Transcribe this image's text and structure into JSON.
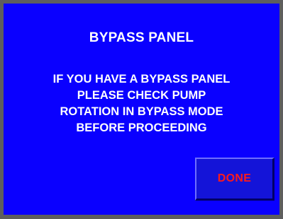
{
  "panel": {
    "title": "BYPASS PANEL",
    "message_lines": [
      "IF YOU HAVE A BYPASS PANEL",
      "PLEASE CHECK PUMP",
      "ROTATION IN BYPASS MODE",
      "BEFORE PROCEEDING"
    ],
    "done_label": "DONE"
  },
  "colors": {
    "screen_background": "#0a00ff",
    "frame": "#5e5e5e",
    "text": "#ffffff",
    "button_face": "#1414d8",
    "button_text": "#ff1a1a"
  }
}
